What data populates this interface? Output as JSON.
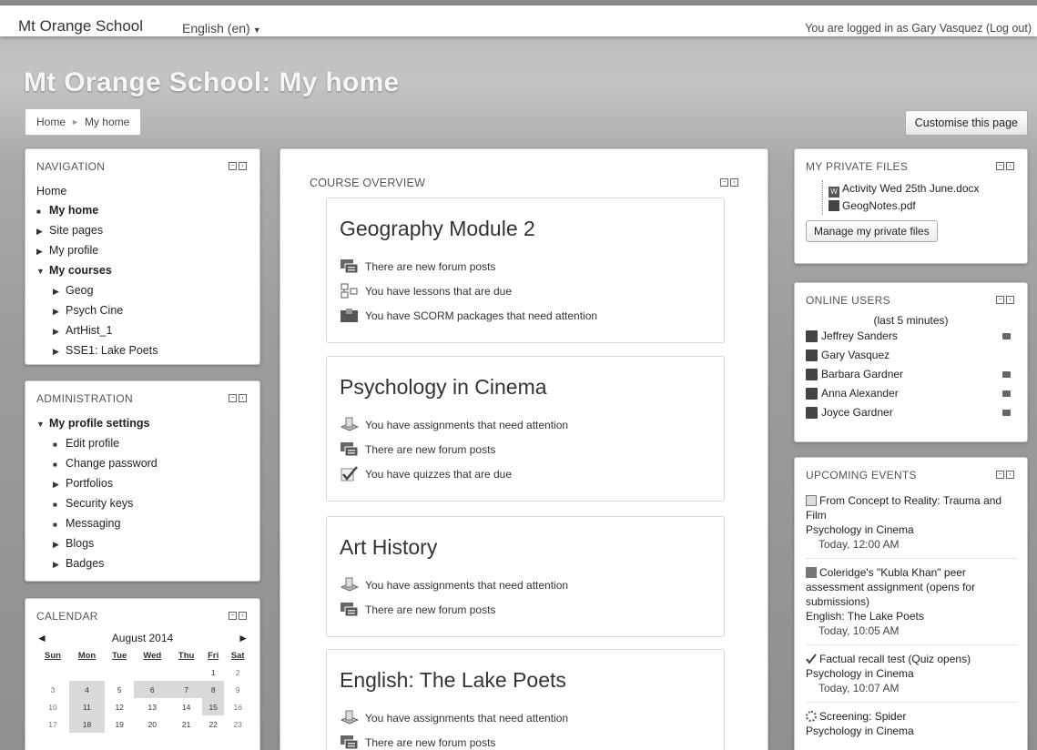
{
  "topbar": {
    "brand": "Mt Orange School",
    "language": "English (en)",
    "login_text": "You are logged in as Gary Vasquez",
    "logout": "(Log out)"
  },
  "page": {
    "heading": "Mt Orange School: My home",
    "breadcrumb": [
      "Home",
      "My home"
    ],
    "customise_button": "Customise this page"
  },
  "navigation": {
    "title": "NAVIGATION",
    "home": "Home",
    "items": [
      {
        "label": "My home"
      },
      {
        "label": "Site pages"
      },
      {
        "label": "My profile"
      },
      {
        "label": "My courses"
      }
    ],
    "courses": [
      "Geog",
      "Psych Cine",
      "ArtHist_1",
      "SSE1: Lake Poets"
    ]
  },
  "administration": {
    "title": "ADMINISTRATION",
    "section": "My profile settings",
    "items": [
      "Edit profile",
      "Change password",
      "Portfolios",
      "Security keys",
      "Messaging",
      "Blogs",
      "Badges"
    ]
  },
  "calendar": {
    "title": "CALENDAR",
    "month": "August 2014",
    "prev": "◄",
    "next": "►",
    "days": [
      "Sun",
      "Mon",
      "Tue",
      "Wed",
      "Thu",
      "Fri",
      "Sat"
    ],
    "weeks": [
      [
        "",
        "",
        "",
        "",
        "",
        "1",
        "2"
      ],
      [
        "3",
        "4",
        "5",
        "6",
        "7",
        "8",
        "9"
      ],
      [
        "10",
        "11",
        "12",
        "13",
        "14",
        "15",
        "16"
      ],
      [
        "17",
        "18",
        "19",
        "20",
        "21",
        "22",
        "23"
      ]
    ]
  },
  "course_overview": {
    "title": "COURSE OVERVIEW",
    "courses": [
      {
        "name": "Geography Module 2",
        "notes": [
          "There are new forum posts",
          "You have lessons that are due",
          "You have SCORM packages that need attention"
        ]
      },
      {
        "name": "Psychology in Cinema",
        "notes": [
          "You have assignments that need attention",
          "There are new forum posts",
          "You have quizzes that are due"
        ]
      },
      {
        "name": "Art History",
        "notes": [
          "You have assignments that need attention",
          "There are new forum posts"
        ]
      },
      {
        "name": "English: The Lake Poets",
        "notes": [
          "You have assignments that need attention",
          "There are new forum posts"
        ]
      }
    ]
  },
  "private_files": {
    "title": "MY PRIVATE FILES",
    "files": [
      "Activity Wed 25th June.docx",
      "GeogNotes.pdf"
    ],
    "button": "Manage my private files"
  },
  "online_users": {
    "title": "ONLINE USERS",
    "subtitle": "(last 5 minutes)",
    "users": [
      "Jeffrey Sanders",
      "Gary Vasquez",
      "Barbara Gardner",
      "Anna Alexander",
      "Joyce Gardner"
    ]
  },
  "upcoming_events": {
    "title": "UPCOMING EVENTS",
    "events": [
      {
        "name": "From Concept to Reality: Trauma and Film",
        "course": "Psychology in Cinema",
        "date": "Today, 12:00 AM"
      },
      {
        "name": "Coleridge's \"Kubla Khan\" peer assessment assignment (opens for submissions)",
        "course": "English: The Lake Poets",
        "date": "Today, 10:05 AM"
      },
      {
        "name": "Factual recall test (Quiz opens)",
        "course": "Psychology in Cinema",
        "date": "Today, 10:07 AM"
      },
      {
        "name": "Screening: Spider",
        "course": "Psychology in Cinema",
        "date": ""
      }
    ]
  }
}
